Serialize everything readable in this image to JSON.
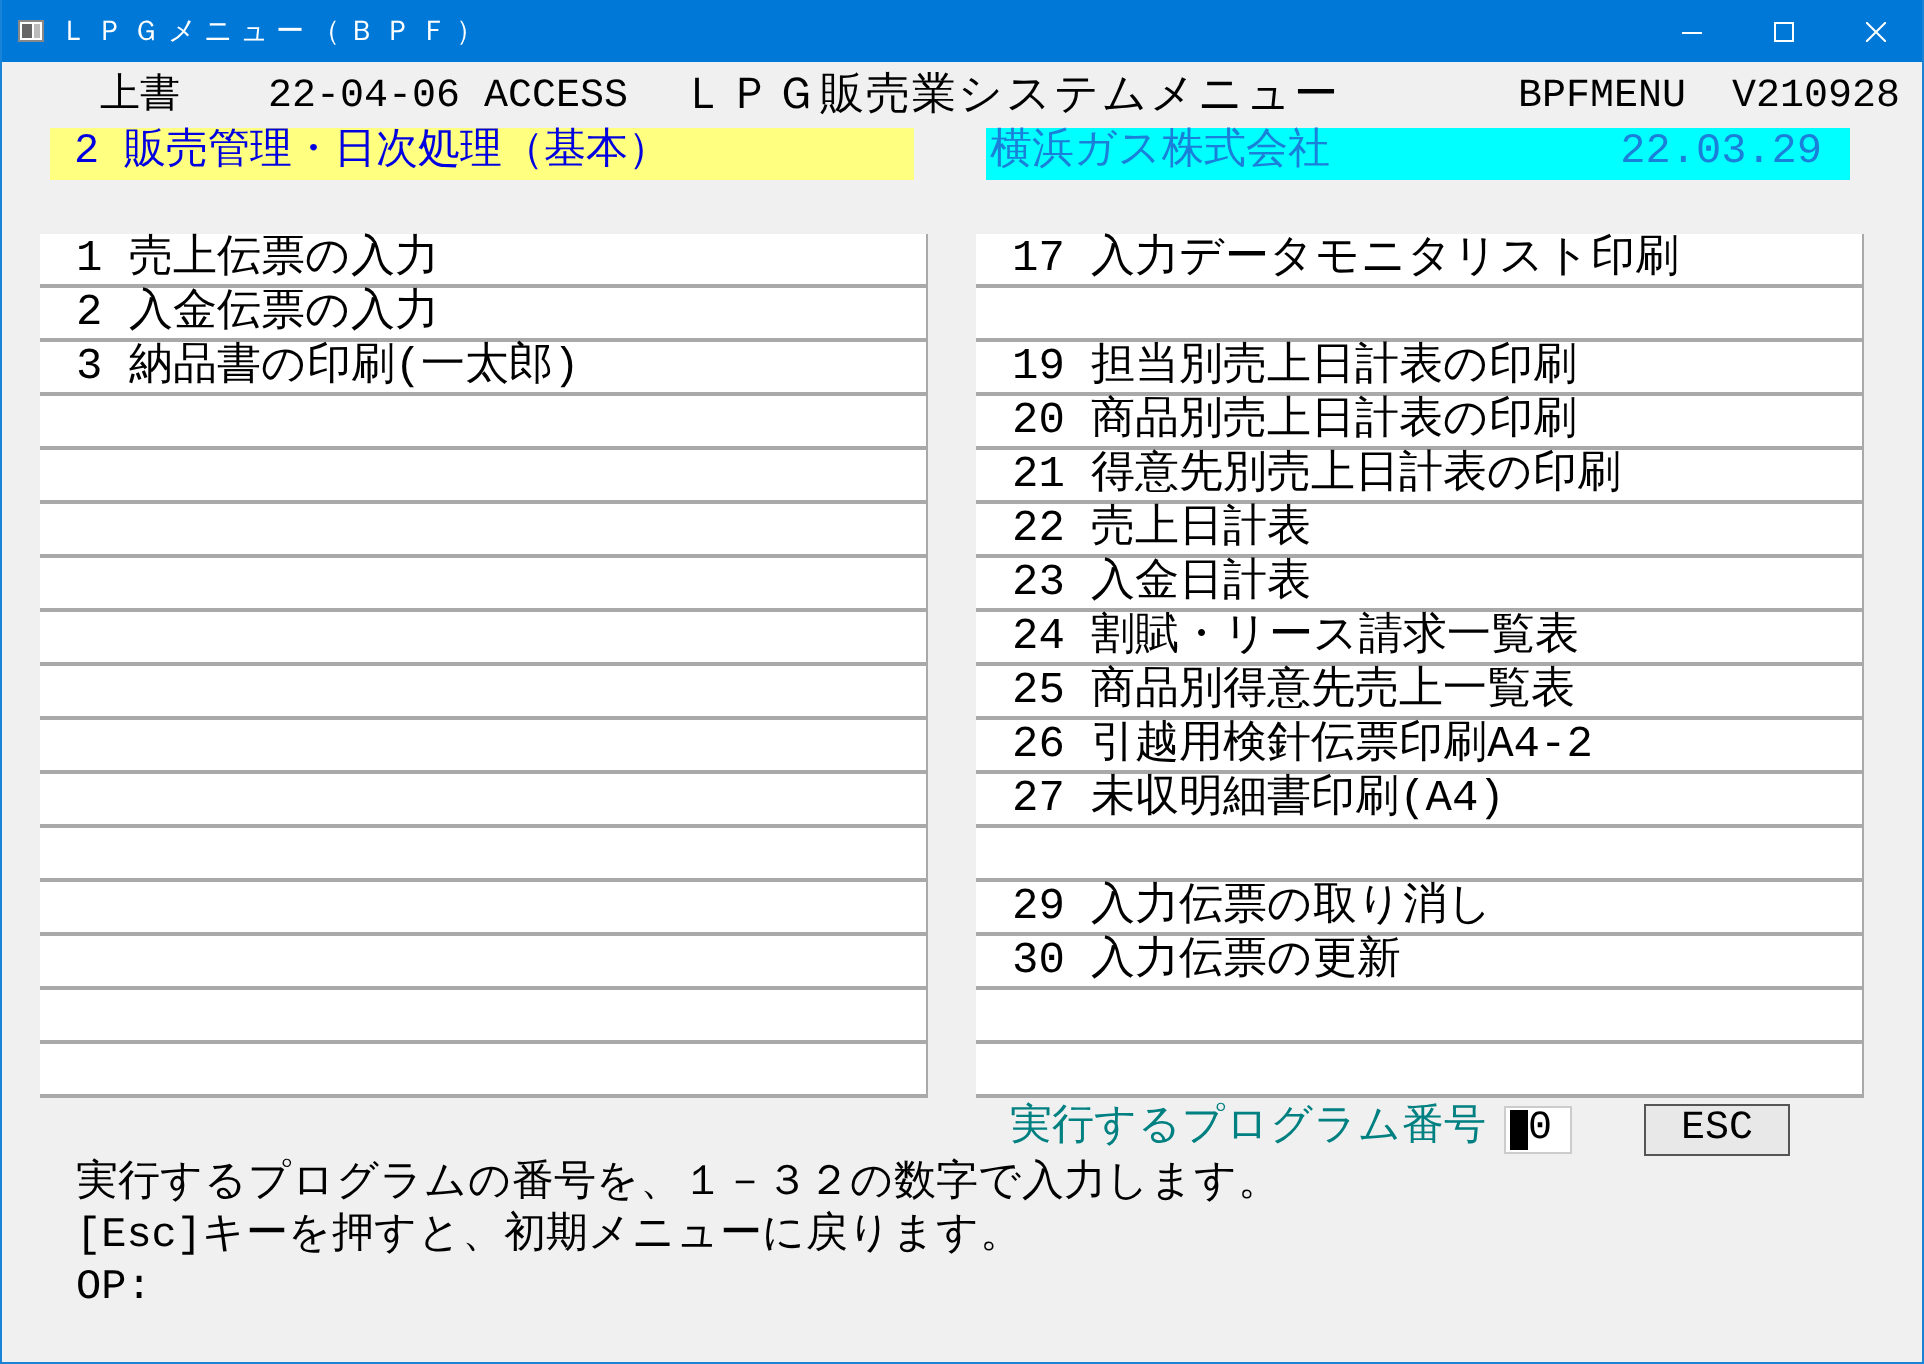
{
  "window": {
    "title": "ＬＰＧメニュー（ＢＰＦ）"
  },
  "header": {
    "mode": "上書",
    "date_db": "22-04-06 ACCESS",
    "system_title": "ＬＰＧ販売業システムメニュー",
    "program_id": "BPFMENU",
    "version": "V210928"
  },
  "menu_bar": {
    "menu_title": "2 販売管理・日次処理（基本）",
    "company": "横浜ガス株式会社",
    "date": "22.03.29"
  },
  "columns": [
    {
      "items": [
        {
          "kind": "program",
          "label": "1 売上伝票の入力"
        },
        {
          "kind": "program",
          "label": "2 入金伝票の入力"
        },
        {
          "kind": "program",
          "label": "3 納品書の印刷(一太郎)"
        },
        {
          "kind": "blank"
        },
        {
          "kind": "blank"
        },
        {
          "kind": "blank"
        },
        {
          "kind": "blank"
        },
        {
          "kind": "blank"
        },
        {
          "kind": "blank"
        },
        {
          "kind": "blank"
        },
        {
          "kind": "blank"
        },
        {
          "kind": "blank"
        },
        {
          "kind": "blank"
        },
        {
          "kind": "blank"
        },
        {
          "kind": "blank"
        },
        {
          "kind": "blank"
        }
      ]
    },
    {
      "items": [
        {
          "kind": "program",
          "label": "17 入力データモニタリスト印刷"
        },
        {
          "kind": "blank"
        },
        {
          "kind": "program",
          "label": "19 担当別売上日計表の印刷"
        },
        {
          "kind": "program",
          "label": "20 商品別売上日計表の印刷"
        },
        {
          "kind": "program",
          "label": "21 得意先別売上日計表の印刷"
        },
        {
          "kind": "program",
          "label": "22 売上日計表"
        },
        {
          "kind": "program",
          "label": "23 入金日計表"
        },
        {
          "kind": "program",
          "label": "24 割賦・リース請求一覧表"
        },
        {
          "kind": "program",
          "label": "25 商品別得意先売上一覧表"
        },
        {
          "kind": "program",
          "label": "26 引越用検針伝票印刷A4-2"
        },
        {
          "kind": "program",
          "label": "27 未収明細書印刷(A4)"
        },
        {
          "kind": "blank"
        },
        {
          "kind": "program",
          "label": "29 入力伝票の取り消し"
        },
        {
          "kind": "program",
          "label": "30 入力伝票の更新"
        },
        {
          "kind": "blank"
        },
        {
          "kind": "blank"
        }
      ]
    }
  ],
  "prompt": {
    "label": "実行するプログラム番号",
    "value": "0",
    "button": "ESC"
  },
  "messages": [
    "実行するプログラムの番号を、１－３２の数字で入力します。",
    "[Esc]キーを押すと、初期メニューに戻ります。",
    "OP:"
  ]
}
